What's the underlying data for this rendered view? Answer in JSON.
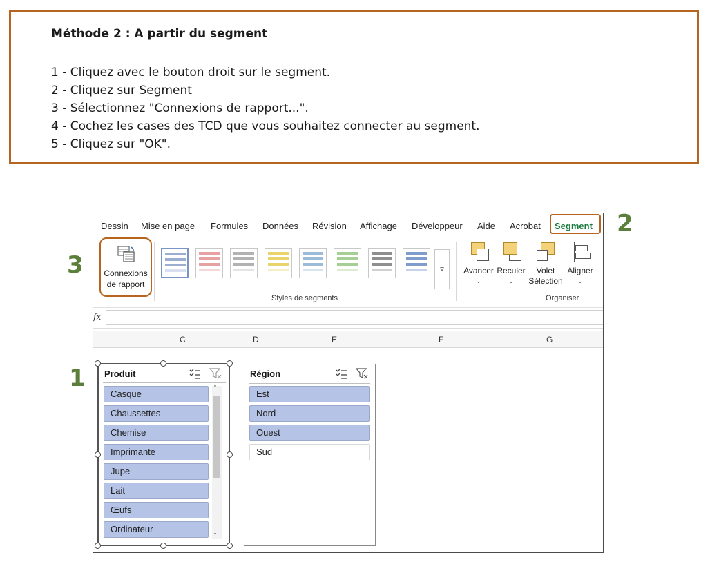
{
  "instructions": {
    "title": "Méthode 2 :  A  partir du segment",
    "steps": [
      "1 - Cliquez avec le bouton droit sur le segment.",
      "2 - Cliquez sur Segment",
      "3 - Sélectionnez \"Connexions de rapport...\".",
      "4 - Cochez les cases des TCD que vous souhaitez connecter au segment.",
      "5 - Cliquez sur \"OK\"."
    ]
  },
  "markers": {
    "m1": "1",
    "m2": "2",
    "m3": "3"
  },
  "ribbon": {
    "tabs": [
      "Dessin",
      "Mise en page",
      "Formules",
      "Données",
      "Révision",
      "Affichage",
      "Développeur",
      "Aide",
      "Acrobat",
      "Segment"
    ],
    "active_tab": "Segment",
    "connexions_line1": "Connexions",
    "connexions_line2": "de rapport",
    "styles_label": "Styles de segments",
    "organiser_label": "Organiser",
    "avancer": "Avancer",
    "reculer": "Reculer",
    "volet_line1": "Volet",
    "volet_line2": "Sélection",
    "aligner": "Aligner"
  },
  "formula_bar": {
    "fx_label": "fx",
    "value": ""
  },
  "columns": [
    "C",
    "D",
    "E",
    "F",
    "G"
  ],
  "slicer_produit": {
    "title": "Produit",
    "items": [
      "Casque",
      "Chaussettes",
      "Chemise",
      "Imprimante",
      "Jupe",
      "Lait",
      "Œufs",
      "Ordinateur"
    ]
  },
  "slicer_region": {
    "title": "Région",
    "items": [
      "Est",
      "Nord",
      "Ouest",
      "Sud"
    ],
    "selected": [
      "Est",
      "Nord",
      "Ouest"
    ]
  },
  "colors": {
    "accent_orange": "#b5651d",
    "marker_green": "#5b7f3a",
    "segment_tab_green": "#1a7a3d",
    "slicer_selected": "#b4c3e6"
  }
}
